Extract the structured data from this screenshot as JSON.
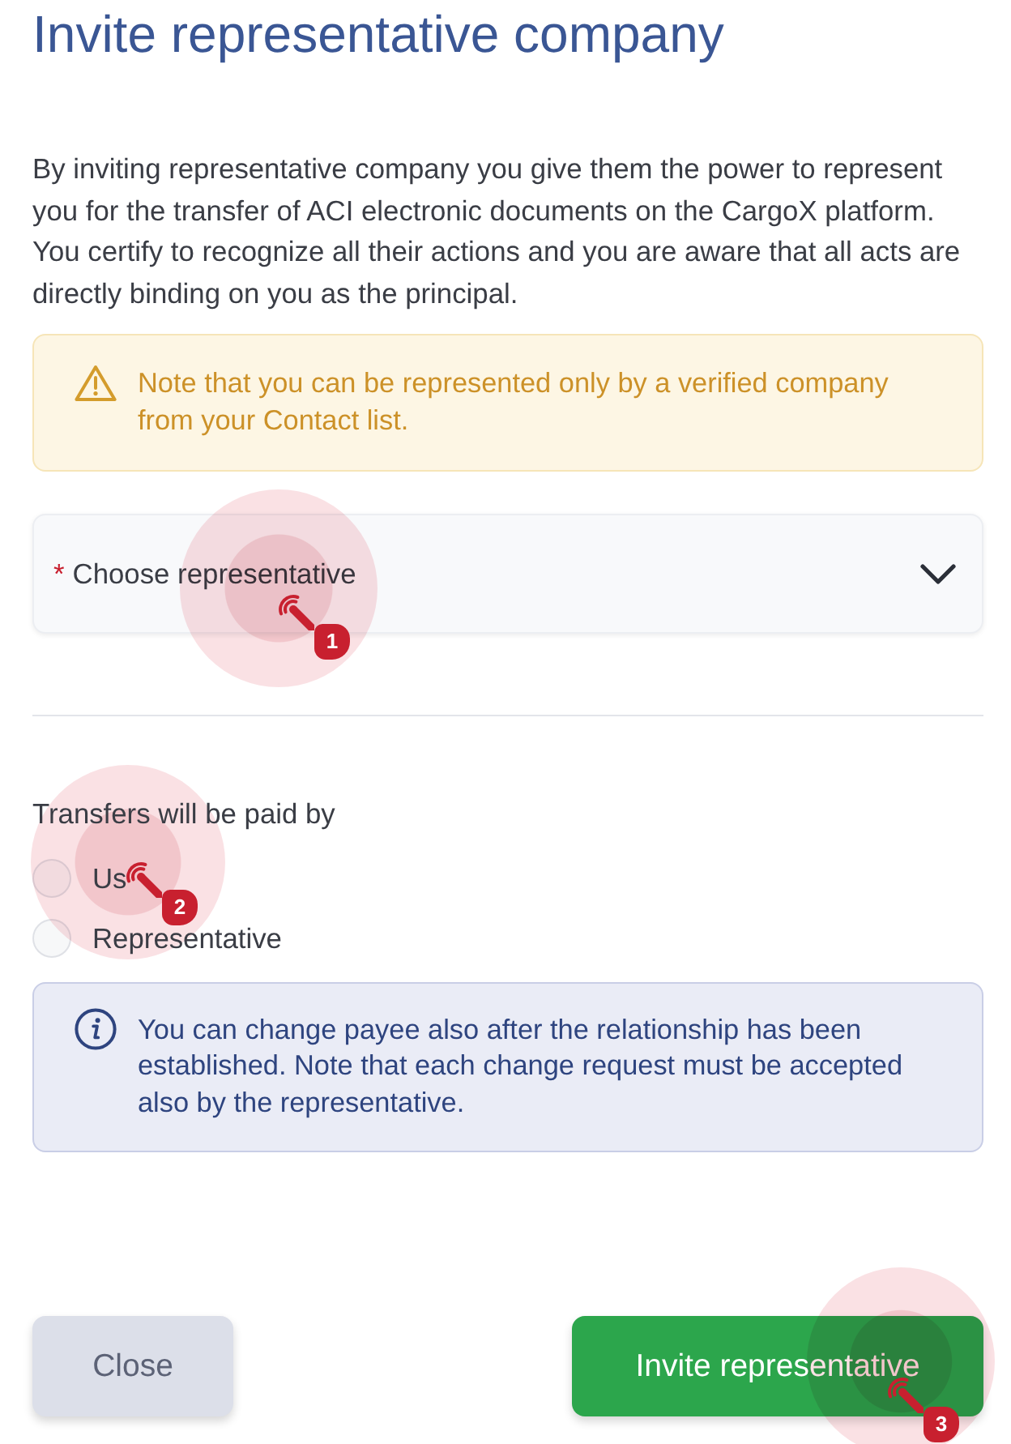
{
  "dialog": {
    "title": "Invite representative company",
    "description": "By inviting representative company you give them the power to represent you for the transfer of ACI electronic documents on the CargoX platform. You certify to recognize all their actions and you are aware that all acts are directly binding on you as the principal.",
    "warning": {
      "text": "Note that you can be represented only by a verified company from your Contact list."
    },
    "representative_select": {
      "required_mark": "*",
      "placeholder": "Choose representative",
      "expanded": false,
      "tutorial_step": "1"
    },
    "payment": {
      "label": "Transfers will be paid by",
      "options": [
        {
          "label": "Us",
          "selected": false,
          "tutorial_step": "2"
        },
        {
          "label": "Representative",
          "selected": false
        }
      ]
    },
    "info": {
      "text": "You can change payee also after the relationship has been established. Note that each change request must be accepted also by the representative."
    },
    "buttons": [
      {
        "label": "Close",
        "kind": "secondary"
      },
      {
        "label": "Invite representative",
        "kind": "primary",
        "tutorial_step": "3"
      }
    ]
  }
}
